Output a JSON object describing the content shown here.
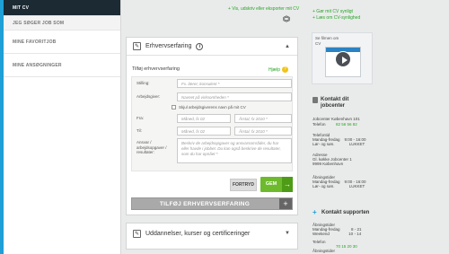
{
  "nav": {
    "items": [
      {
        "label": "MIT CV",
        "active": true
      },
      {
        "label": "JEG SØGER JOB SOM"
      },
      {
        "label": "MINE FAVORITJOB"
      },
      {
        "label": "MINE ANSØGNINGER"
      }
    ]
  },
  "main": {
    "top_link": "+ Vis, udskriv eller eksporter mit CV",
    "experience": {
      "title": "Erhvervserfaring",
      "subtitle": "Tilføj erhvervserfaring",
      "help": "Hjælp",
      "fields": {
        "stilling_label": "Stilling:",
        "stilling_placeholder": "Fx. lærer, konsulent *",
        "arbejdsgiver_label": "Arbejdsgiver:",
        "arbejdsgiver_placeholder": "Navnet på virksomheden *",
        "skjul_label": "Skjul arbejdsgiverens navn på mit CV",
        "fra_label": "Fra:",
        "fra_month_placeholder": "Måned, fx 02",
        "fra_year_placeholder": "Årstal, fx 2010 *",
        "til_label": "Til:",
        "til_month_placeholder": "Måned, fx 02",
        "til_year_placeholder": "Årstal, fx 2010 *",
        "ansvar_label": "Ansvar / arbejdsopgaver / resultater:",
        "ansvar_placeholder": "Beskriv de arbejdsopgaver og ansvarsområder, du har eller havde i jobbet. Du kan også beskrive de resultater, som du har opnået *"
      },
      "cancel": "FORTRYD",
      "save": "GEM",
      "add": "TILFØJ ERHVERVSERFARING"
    },
    "education": {
      "title": "Uddannelser, kurser og certificeringer"
    }
  },
  "right": {
    "links": [
      "+ Gør mit CV synligt",
      "+ Læs om CV-synlighed"
    ],
    "video_caption": "Se filmen om\nCV",
    "contact_title": "Kontakt dit\njobcenter",
    "jobcenter_name": "Jobcenter København 101",
    "phone_label": "Telefon",
    "phone": "82 56 56 82",
    "phone_hours": "Telefontid\nMandag-fredag    9:00 - 16:00\nLør- og søn.             LUKKET",
    "address": "Adresse\nGl. køkke Jobcenter 1\n9999 København",
    "open_hours": "Åbningstider\nMandag-fredag    9:00 - 16:00\nLør- og søn.             LUKKET",
    "support_title": "Kontakt supporten",
    "support_hours": "Åbningstider\nMandag-fredag          8 - 21\nWeekend                 10 - 14",
    "support_phone_label": "Telefon",
    "support_phone": "70 15 20 30",
    "support_open": "Åbningstider"
  }
}
